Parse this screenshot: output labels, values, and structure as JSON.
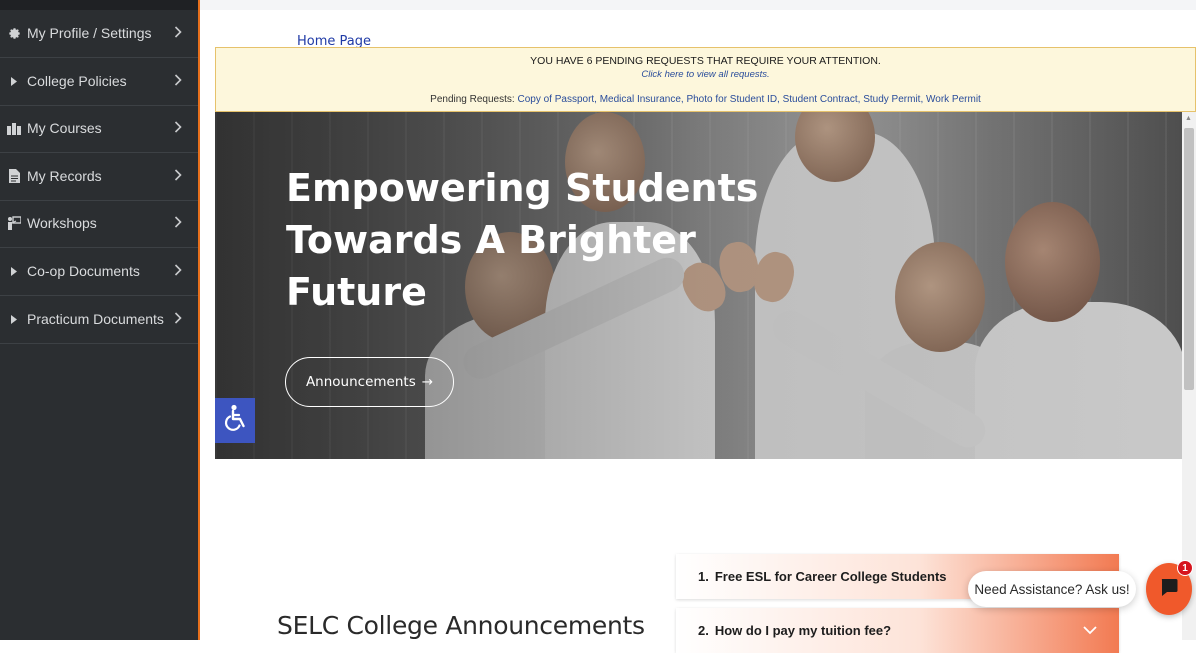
{
  "sidebar": {
    "items": [
      {
        "label": "My Profile / Settings",
        "icon": "gear-icon"
      },
      {
        "label": "College Policies",
        "icon": "caret-right-icon"
      },
      {
        "label": "My Courses",
        "icon": "courses-icon"
      },
      {
        "label": "My Records",
        "icon": "file-icon"
      },
      {
        "label": "Workshops",
        "icon": "workshop-icon"
      },
      {
        "label": "Co-op Documents",
        "icon": "caret-right-icon"
      },
      {
        "label": "Practicum Documents",
        "icon": "caret-right-icon"
      }
    ]
  },
  "breadcrumb": {
    "label": "Home Page"
  },
  "pending": {
    "title": "YOU HAVE 6 PENDING REQUESTS THAT REQUIRE YOUR ATTENTION.",
    "link": "Click here to view all requests.",
    "list_label": "Pending Requests:",
    "list_items": "Copy of Passport, Medical Insurance, Photo for Student ID, Student Contract, Study Permit, Work Permit"
  },
  "hero": {
    "title_line1": "Empowering Students",
    "title_line2": "Towards A Brighter",
    "title_line3": "Future",
    "button_label": "Announcements",
    "button_arrow": "→"
  },
  "announcements": {
    "title": "SELC College Announcements"
  },
  "faq": {
    "items": [
      {
        "num": "1.",
        "question": "Free ESL for Career College Students"
      },
      {
        "num": "2.",
        "question": "How do I pay my tuition fee?"
      }
    ]
  },
  "chat": {
    "assist_label": "Need Assistance? Ask us!",
    "badge_count": "1"
  },
  "colors": {
    "sidebar_bg": "#2b2e31",
    "accent_orange": "#f0592b",
    "access_blue": "#3d55c0",
    "pending_bg": "#fdf7dc"
  }
}
